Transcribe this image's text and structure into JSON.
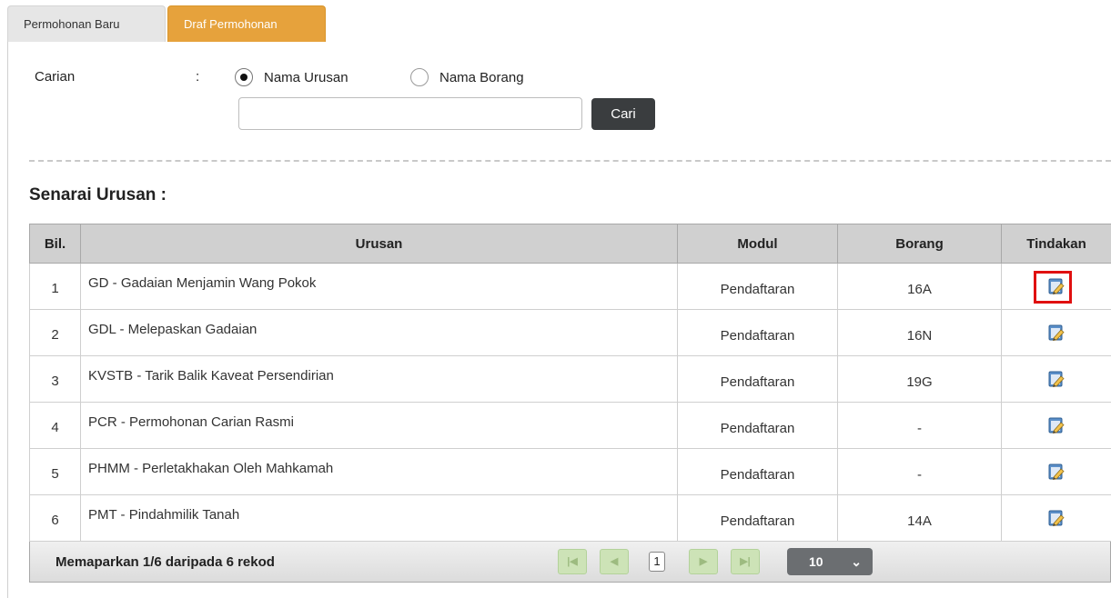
{
  "tabs": [
    {
      "label": "Permohonan Baru",
      "active": false
    },
    {
      "label": "Draf Permohonan",
      "active": true
    }
  ],
  "search": {
    "label": "Carian",
    "colon": ":",
    "options": [
      {
        "label": "Nama Urusan",
        "selected": true
      },
      {
        "label": "Nama Borang",
        "selected": false
      }
    ],
    "value": "",
    "placeholder": "",
    "button_label": "Cari"
  },
  "section_title": "Senarai Urusan :",
  "table": {
    "headers": [
      "Bil.",
      "Urusan",
      "Modul",
      "Borang",
      "Tindakan"
    ],
    "rows": [
      {
        "bil": "1",
        "urusan": "GD - Gadaian Menjamin Wang Pokok",
        "modul": "Pendaftaran",
        "borang": "16A",
        "action_icon": "edit-icon",
        "highlighted": true
      },
      {
        "bil": "2",
        "urusan": "GDL - Melepaskan Gadaian",
        "modul": "Pendaftaran",
        "borang": "16N",
        "action_icon": "edit-icon",
        "highlighted": false
      },
      {
        "bil": "3",
        "urusan": "KVSTB - Tarik Balik Kaveat Persendirian",
        "modul": "Pendaftaran",
        "borang": "19G",
        "action_icon": "edit-icon",
        "highlighted": false
      },
      {
        "bil": "4",
        "urusan": "PCR - Permohonan Carian Rasmi",
        "modul": "Pendaftaran",
        "borang": "-",
        "action_icon": "edit-icon",
        "highlighted": false
      },
      {
        "bil": "5",
        "urusan": "PHMM - Perletakhakan Oleh Mahkamah",
        "modul": "Pendaftaran",
        "borang": "-",
        "action_icon": "edit-icon",
        "highlighted": false
      },
      {
        "bil": "6",
        "urusan": "PMT - Pindahmilik Tanah",
        "modul": "Pendaftaran",
        "borang": "14A",
        "action_icon": "edit-icon",
        "highlighted": false
      }
    ]
  },
  "pagination": {
    "info": "Memaparkan 1/6 daripada 6 rekod",
    "current_page": "1",
    "page_size": "10"
  },
  "colors": {
    "active_tab": "#e6a23c",
    "highlight_border": "#e01010",
    "header_bg": "#d0d0d0"
  }
}
